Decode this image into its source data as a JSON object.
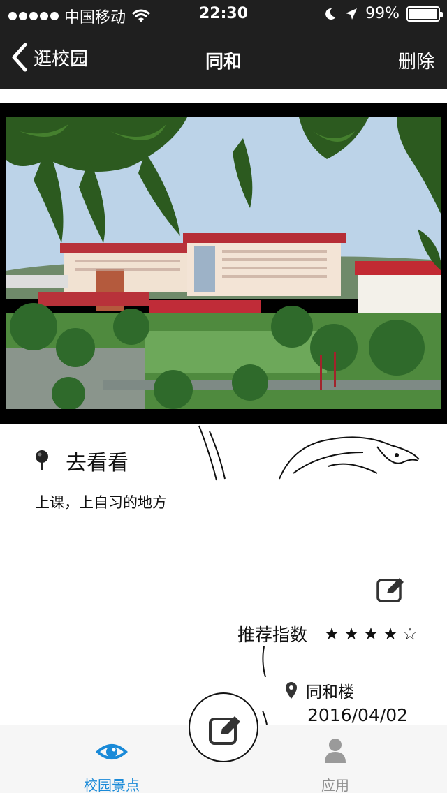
{
  "status_bar": {
    "carrier": "中国移动",
    "time": "22:30",
    "battery": "99%",
    "battery_level": 0.99,
    "icons": [
      "signal-dots-icon",
      "wifi-icon",
      "moon-icon",
      "location-arrow-icon",
      "battery-icon"
    ]
  },
  "nav": {
    "back_label": "逛校园",
    "title": "同和",
    "delete_label": "删除"
  },
  "photo": {
    "description_icon": "campus-photo"
  },
  "detail": {
    "go_label": "去看看",
    "description": "上课，上自习的地方",
    "recommend_label": "推荐指数",
    "rating": 4,
    "rating_max": 5,
    "stars": "★★★★☆",
    "location": "同和楼",
    "date": "2016/04/02"
  },
  "tabs": [
    {
      "label": "校园景点",
      "icon": "eye-icon",
      "active": true
    },
    {
      "label": "应用",
      "icon": "person-icon",
      "active": false
    }
  ],
  "colors": {
    "nav_bg": "#1f1f1f",
    "accent": "#1a8ad8",
    "tab_inactive": "#8f8f8f"
  }
}
